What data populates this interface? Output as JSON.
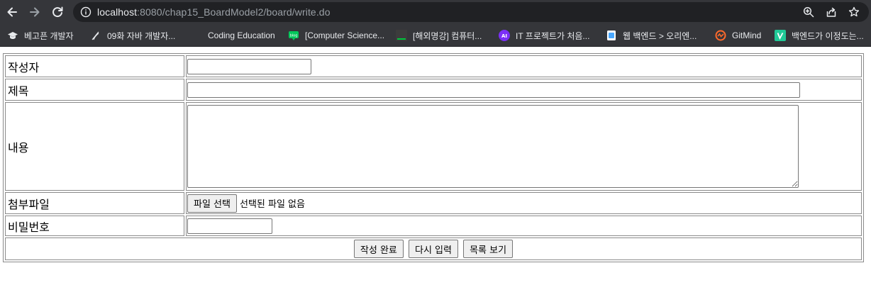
{
  "browser": {
    "url_host": "localhost",
    "url_rest": ":8080/chap15_BoardModel2/board/write.do",
    "bookmarks": [
      {
        "label": "베고픈 개발자",
        "icon": "graduation-cap-icon",
        "color": "#e8eaed"
      },
      {
        "label": "09화 자바 개발자...",
        "icon": "pen-nib-icon",
        "color": "#e8eaed"
      },
      {
        "label": "Coding Education",
        "icon": "blank-page-icon",
        "color": "#35363a"
      },
      {
        "label": "[Computer Science...",
        "icon": "naver-blog-icon",
        "color": "#03c75a"
      },
      {
        "label": "[해외명강] 컴퓨터...",
        "icon": "green-bar-icon",
        "color": "#00c73c"
      },
      {
        "label": "IT 프로젝트가 처음...",
        "icon": "purple-logo-icon",
        "color": "#7b2ff7"
      },
      {
        "label": "웹 백엔드 > 오리엔...",
        "icon": "doc-icon",
        "color": "#4aa8ff"
      },
      {
        "label": "GitMind",
        "icon": "gitmind-icon",
        "color": "#ff6a2b"
      },
      {
        "label": "백엔드가 이정도는...",
        "icon": "velog-icon",
        "color": "#20c997"
      }
    ]
  },
  "form": {
    "writer_label": "작성자",
    "writer_value": "",
    "title_label": "제목",
    "title_value": "",
    "content_label": "내용",
    "content_value": "",
    "file_label": "첨부파일",
    "file_button": "파일 선택",
    "file_status": "선택된 파일 없음",
    "password_label": "비밀번호",
    "password_value": "",
    "submit_label": "작성 완료",
    "reset_label": "다시 입력",
    "list_label": "목록 보기"
  }
}
